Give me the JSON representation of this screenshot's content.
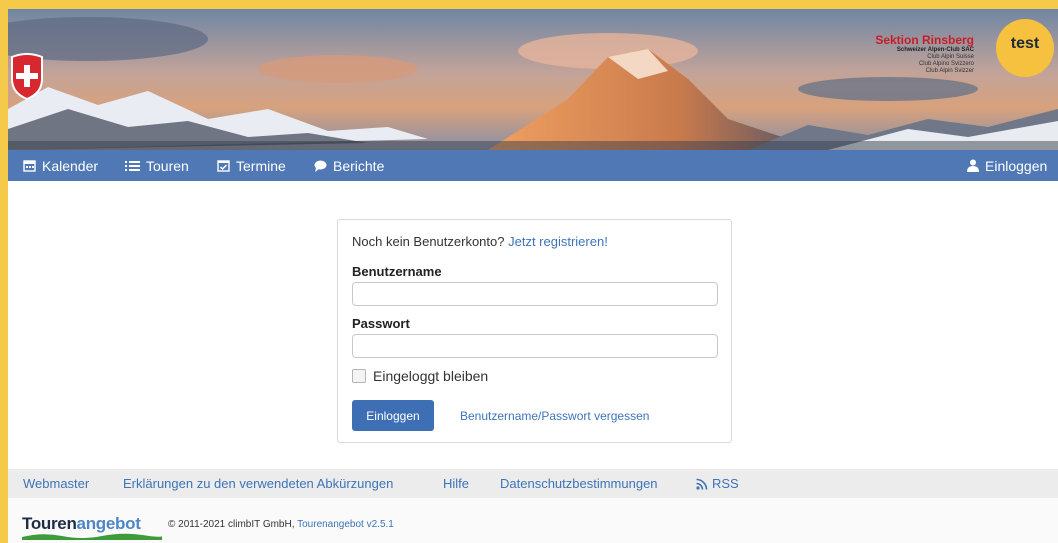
{
  "banner": {
    "section_title": "Sektion Rinsberg",
    "org_lines": [
      "Schweizer Alpen-Club SAC",
      "Club Alpin Suisse",
      "Club Alpino Svizzero",
      "Club Alpin Svizzer"
    ],
    "badge": "test"
  },
  "nav": {
    "items": [
      {
        "label": "Kalender",
        "icon": "calendar-icon"
      },
      {
        "label": "Touren",
        "icon": "list-icon"
      },
      {
        "label": "Termine",
        "icon": "calendar-check-icon"
      },
      {
        "label": "Berichte",
        "icon": "speech-bubble-icon"
      }
    ],
    "login": {
      "label": "Einloggen",
      "icon": "user-icon"
    }
  },
  "login_form": {
    "no_account_text": "Noch kein Benutzerkonto?",
    "register_link": "Jetzt registrieren!",
    "username_label": "Benutzername",
    "username_value": "",
    "password_label": "Passwort",
    "password_value": "",
    "remember_label": "Eingeloggt bleiben",
    "remember_checked": false,
    "submit_label": "Einloggen",
    "forgot_link": "Benutzername/Passwort vergessen"
  },
  "footer": {
    "links": [
      "Webmaster",
      "Erklärungen zu den verwendeten Abkürzungen",
      "Hilfe",
      "Datenschutzbestimmungen",
      "RSS"
    ],
    "brand_part1": "Touren",
    "brand_part2": "angebot",
    "copyright": "© 2011-2021 climbIT GmbH,",
    "version": "Tourenangebot v2.5.1"
  },
  "colors": {
    "nav_bg": "#4f78b4",
    "accent_yellow": "#f5c94a",
    "link": "#3d74b8",
    "button": "#3e6fb4"
  }
}
